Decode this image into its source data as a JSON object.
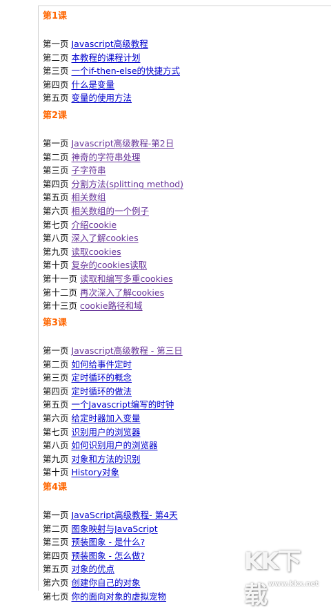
{
  "lessons": [
    {
      "title": "第1课",
      "pages": [
        {
          "num": "第一页",
          "link": "Javascript高级教程",
          "visited": false
        },
        {
          "num": "第二页",
          "link": "本教程的课程计划",
          "visited": false
        },
        {
          "num": "第三页",
          "link": "一个if-then-else的快捷方式",
          "visited": false
        },
        {
          "num": "第四页",
          "link": "什么是变量",
          "visited": false
        },
        {
          "num": "第五页",
          "link": "变量的使用方法",
          "visited": false
        }
      ]
    },
    {
      "title": "第2课",
      "pages": [
        {
          "num": "第一页",
          "link": "Javascript高级教程-第2日",
          "visited": true
        },
        {
          "num": "第二页",
          "link": "神奇的字符串处理",
          "visited": true
        },
        {
          "num": "第三页",
          "link": "子字符串",
          "visited": true
        },
        {
          "num": "第四页",
          "link": "分割方法(splitting method)",
          "visited": true
        },
        {
          "num": "第五页",
          "link": "相关数组",
          "visited": true
        },
        {
          "num": "第六页",
          "link": "相关数组的一个例子",
          "visited": true
        },
        {
          "num": "第七页",
          "link": "介绍cookie",
          "visited": true
        },
        {
          "num": "第八页",
          "link": "深入了解cookies",
          "visited": true
        },
        {
          "num": "第九页",
          "link": "读取cookies",
          "visited": true
        },
        {
          "num": "第十页",
          "link": "复杂的cookies读取",
          "visited": true
        },
        {
          "num": "第十一页",
          "link": "读取和编写多重cookies",
          "visited": true
        },
        {
          "num": "第十二页",
          "link": "再次深入了解cookies",
          "visited": true
        },
        {
          "num": "第十三页",
          "link": "cookie路径和域",
          "visited": true
        }
      ]
    },
    {
      "title": "第3课",
      "pages": [
        {
          "num": "第一页",
          "link": "Javascript高级教程 - 第三日",
          "visited": true
        },
        {
          "num": "第二页",
          "link": "如何给事件定时",
          "visited": false
        },
        {
          "num": "第三页",
          "link": "定时循环的概念",
          "visited": false
        },
        {
          "num": "第四页",
          "link": "定时循环的做法",
          "visited": false
        },
        {
          "num": "第五页",
          "link": "一个Javascript编写的时钟",
          "visited": false
        },
        {
          "num": "第六页",
          "link": "给定时器加入变量",
          "visited": false
        },
        {
          "num": "第七页",
          "link": "识别用户的浏览器",
          "visited": false
        },
        {
          "num": "第八页",
          "link": "如何识别用户的浏览器",
          "visited": false
        },
        {
          "num": "第九页",
          "link": "对象和方法的识别",
          "visited": false
        },
        {
          "num": "第十页",
          "link": "History对象",
          "visited": false
        }
      ]
    },
    {
      "title": "第4课",
      "pages": [
        {
          "num": "第一页",
          "link": "JavaScript高级教程- 第4天",
          "visited": false
        },
        {
          "num": "第二页",
          "link": "图象映射与JavaScript",
          "visited": false
        },
        {
          "num": "第三页",
          "link": "预装图象 - 是什么?",
          "visited": false
        },
        {
          "num": "第四页",
          "link": "预装图象 - 怎么做?",
          "visited": false
        },
        {
          "num": "第五页",
          "link": "对象的优点",
          "visited": false
        },
        {
          "num": "第六页",
          "link": "创建你自己的对象",
          "visited": false
        },
        {
          "num": "第七页",
          "link": "你的面向对象的虚拟宠物",
          "visited": false
        }
      ]
    }
  ],
  "watermark": {
    "logo": "KK下载",
    "url": "www.kkx.net"
  },
  "colors": {
    "lesson_title": "#ff6600",
    "link": "#0000cc",
    "visited_link": "#663399"
  }
}
